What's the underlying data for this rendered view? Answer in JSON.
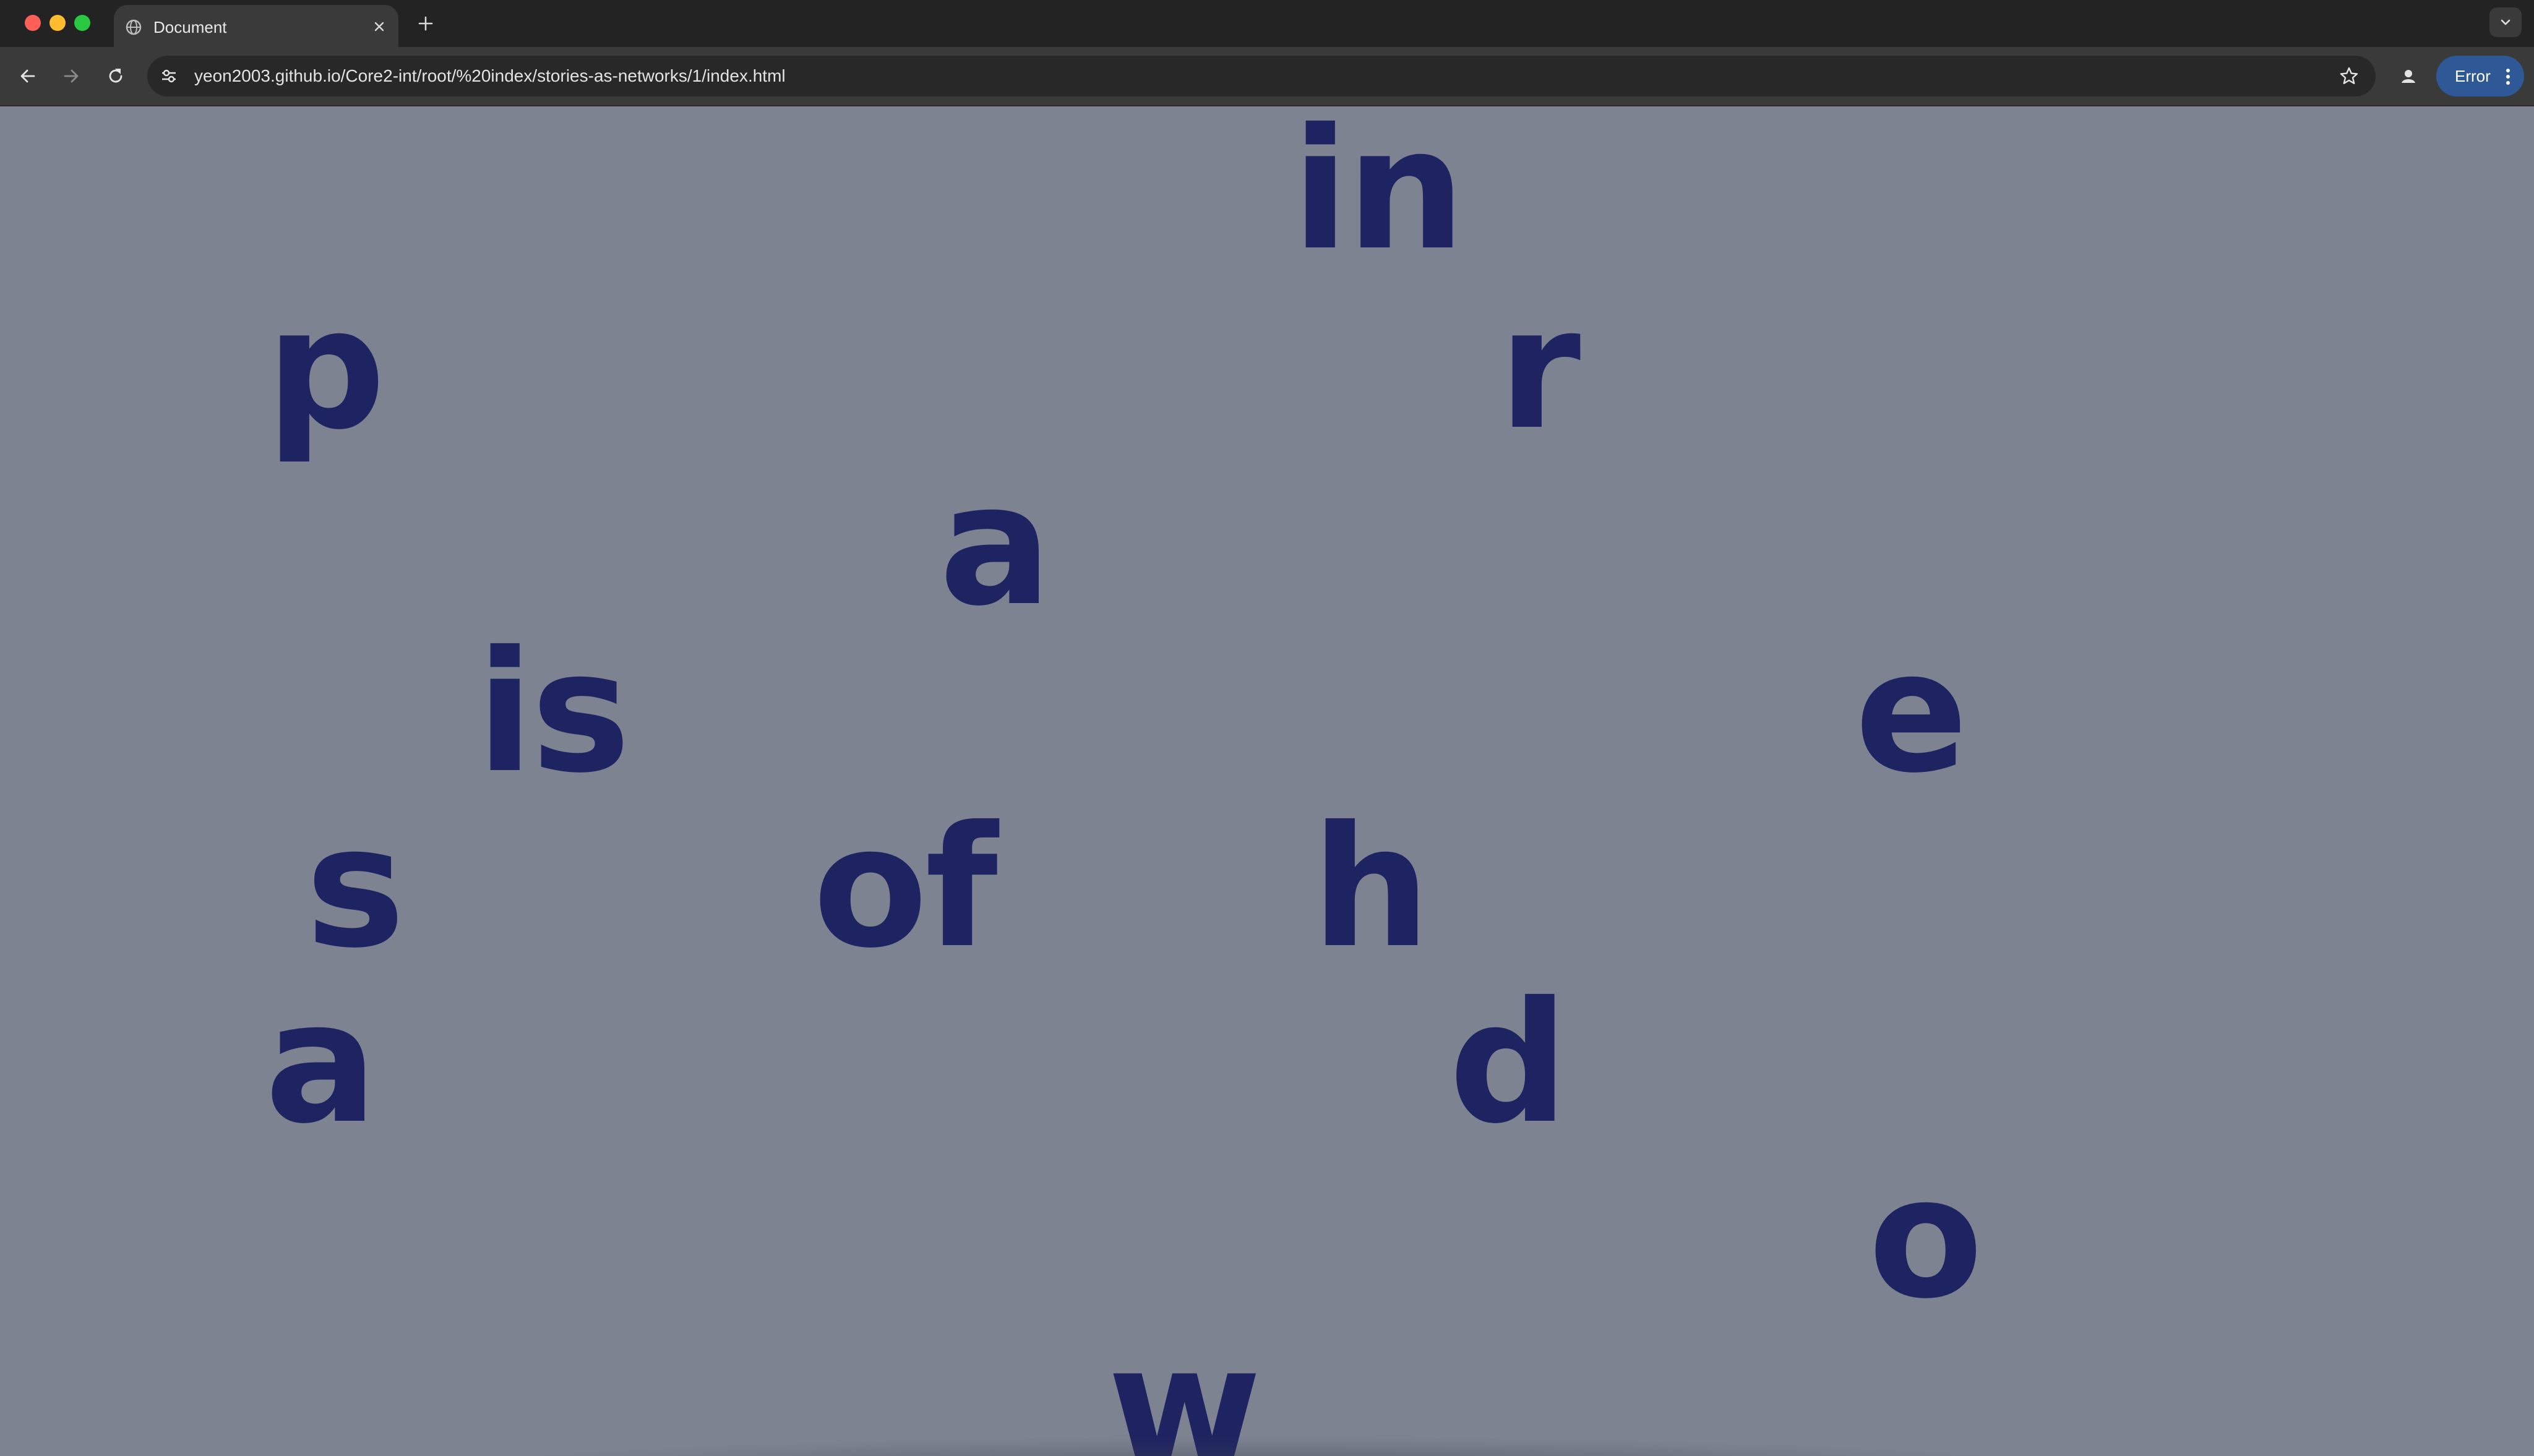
{
  "browser": {
    "tab": {
      "title": "Document"
    },
    "address_bar": {
      "url": "yeon2003.github.io/Core2-int/root/%20index/stories-as-networks/1/index.html"
    },
    "error_button": {
      "label": "Error"
    }
  },
  "page": {
    "background_color": "#7e8391",
    "text_color": "#1e2461",
    "words": [
      {
        "id": "in",
        "text": "in"
      },
      {
        "id": "p",
        "text": "p"
      },
      {
        "id": "r",
        "text": "r"
      },
      {
        "id": "a1",
        "text": "a"
      },
      {
        "id": "is",
        "text": "is"
      },
      {
        "id": "e",
        "text": "e"
      },
      {
        "id": "s",
        "text": "s"
      },
      {
        "id": "of",
        "text": "of"
      },
      {
        "id": "h",
        "text": "h"
      },
      {
        "id": "a2",
        "text": "a"
      },
      {
        "id": "d",
        "text": "d"
      },
      {
        "id": "o",
        "text": "o"
      },
      {
        "id": "w",
        "text": "w"
      }
    ]
  },
  "icons": {
    "tab_favicon": "globe-icon",
    "tab_close": "close-icon",
    "new_tab": "plus-icon",
    "tab_search": "chevron-down-icon",
    "back": "arrow-left-icon",
    "forward": "arrow-right-icon",
    "reload": "reload-icon",
    "site_info": "tune-icon",
    "bookmark": "star-icon",
    "profile": "person-icon",
    "menu": "more-vert-icon"
  }
}
